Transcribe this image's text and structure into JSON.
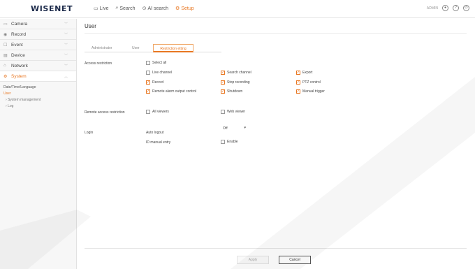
{
  "brand": "WISENET",
  "topnav": [
    {
      "label": "Live",
      "icon": "monitor-icon",
      "active": false
    },
    {
      "label": "Search",
      "icon": "search-icon",
      "active": false
    },
    {
      "label": "AI search",
      "icon": "ai-search-icon",
      "active": false
    },
    {
      "label": "Setup",
      "icon": "gear-icon",
      "active": true
    }
  ],
  "top_right": {
    "user": "ADMIN"
  },
  "sidebar": {
    "items": [
      {
        "label": "Camera",
        "icon": "camera-icon"
      },
      {
        "label": "Record",
        "icon": "record-icon"
      },
      {
        "label": "Event",
        "icon": "event-icon"
      },
      {
        "label": "Device",
        "icon": "device-icon"
      },
      {
        "label": "Network",
        "icon": "network-icon"
      },
      {
        "label": "System",
        "icon": "system-icon",
        "active": true
      }
    ],
    "subitems": [
      {
        "label": "Date/Time/Language"
      },
      {
        "label": "User",
        "active": true
      },
      {
        "label": "System management"
      },
      {
        "label": "Log"
      }
    ]
  },
  "page": {
    "title": "User"
  },
  "tabs": [
    {
      "label": "Administrator"
    },
    {
      "label": "User"
    },
    {
      "label": "Restriction etting",
      "active": true
    },
    {
      "label": ""
    }
  ],
  "access_restriction": {
    "label": "Access restriction",
    "select_all": "Select all",
    "options": [
      {
        "label": "Live channel",
        "checked": false
      },
      {
        "label": "Search channel",
        "checked": true
      },
      {
        "label": "Export",
        "checked": true
      },
      {
        "label": "Record",
        "checked": true
      },
      {
        "label": "Stop recording",
        "checked": true
      },
      {
        "label": "PTZ control",
        "checked": true
      },
      {
        "label": "Remote alarm output control",
        "checked": true
      },
      {
        "label": "Shutdown",
        "checked": true
      },
      {
        "label": "Manual trigger",
        "checked": true
      }
    ]
  },
  "remote_access": {
    "label": "Remote access restriction",
    "options": [
      {
        "label": "All viewers",
        "checked": false
      },
      {
        "label": "Web viewer",
        "checked": false
      }
    ]
  },
  "login": {
    "label": "Login",
    "auto_logout_label": "Auto logout",
    "auto_logout_value": "Off",
    "id_manual_entry_label": "ID manual entry",
    "enable_label": "Enable",
    "enable_checked": false
  },
  "buttons": {
    "apply": "Apply",
    "cancel": "Cancel"
  },
  "colors": {
    "accent": "#e87722",
    "text": "#333333",
    "sidebar_bg": "#f7f7f7"
  }
}
